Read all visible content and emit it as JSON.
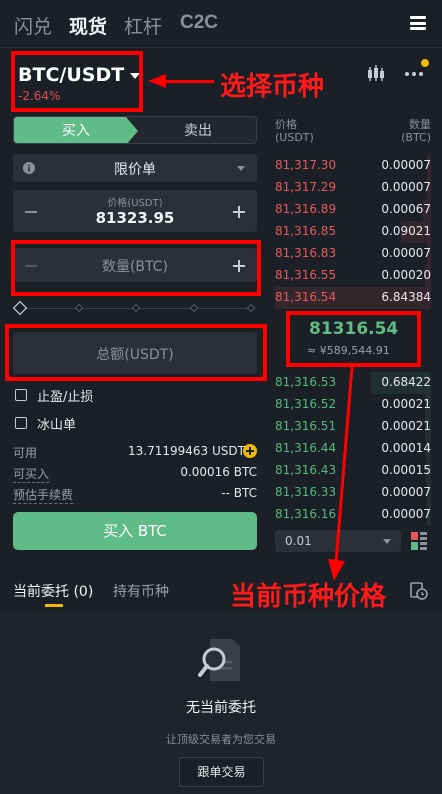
{
  "top_tabs": [
    "闪兑",
    "现货",
    "杠杆",
    "C2C"
  ],
  "active_tab_index": 1,
  "pair": {
    "name": "BTC/USDT",
    "change": "-2.64%"
  },
  "annotations": {
    "select_coin": "选择币种",
    "current_price": "当前币种价格"
  },
  "side": {
    "buy": "买入",
    "sell": "卖出"
  },
  "order_type": "限价单",
  "price_field": {
    "label": "价格(USDT)",
    "value": "81323.95"
  },
  "amount_field": {
    "placeholder": "数量(BTC)"
  },
  "total_field": {
    "placeholder": "总额(USDT)"
  },
  "options": {
    "tp_sl": "止盈/止损",
    "iceberg": "冰山单"
  },
  "info": {
    "available_label": "可用",
    "available_value": "13.71199463 USDT",
    "can_buy_label": "可买入",
    "can_buy_value": "0.00016 BTC",
    "fee_label": "预估手续费",
    "fee_value": "-- BTC"
  },
  "buy_button": "买入 BTC",
  "orderbook": {
    "price_header": "价格",
    "price_unit": "(USDT)",
    "qty_header": "数量",
    "qty_unit": "(BTC)",
    "asks": [
      {
        "price": "81,317.30",
        "qty": "0.00007"
      },
      {
        "price": "81,317.29",
        "qty": "0.00007"
      },
      {
        "price": "81,316.89",
        "qty": "0.00067"
      },
      {
        "price": "81,316.85",
        "qty": "0.09021"
      },
      {
        "price": "81,316.83",
        "qty": "0.00007"
      },
      {
        "price": "81,316.55",
        "qty": "0.00020"
      },
      {
        "price": "81,316.54",
        "qty": "6.84384"
      }
    ],
    "mid_price": "81316.54",
    "mid_cny": "≈ ¥589,544.91",
    "bids": [
      {
        "price": "81,316.53",
        "qty": "0.68422"
      },
      {
        "price": "81,316.52",
        "qty": "0.00021"
      },
      {
        "price": "81,316.51",
        "qty": "0.00021"
      },
      {
        "price": "81,316.44",
        "qty": "0.00014"
      },
      {
        "price": "81,316.43",
        "qty": "0.00015"
      },
      {
        "price": "81,316.33",
        "qty": "0.00007"
      },
      {
        "price": "81,316.16",
        "qty": "0.00007"
      }
    ],
    "precision": "0.01"
  },
  "bottom_tabs": {
    "open_orders": "当前委托 (0)",
    "holdings": "持有币种"
  },
  "empty": {
    "title": "无当前委托",
    "subtitle": "让顶级交易者为您交易",
    "button": "跟单交易"
  },
  "colors": {
    "buy": "#5fbc86",
    "sell": "#e5595e",
    "annotation": "#ff0000"
  }
}
